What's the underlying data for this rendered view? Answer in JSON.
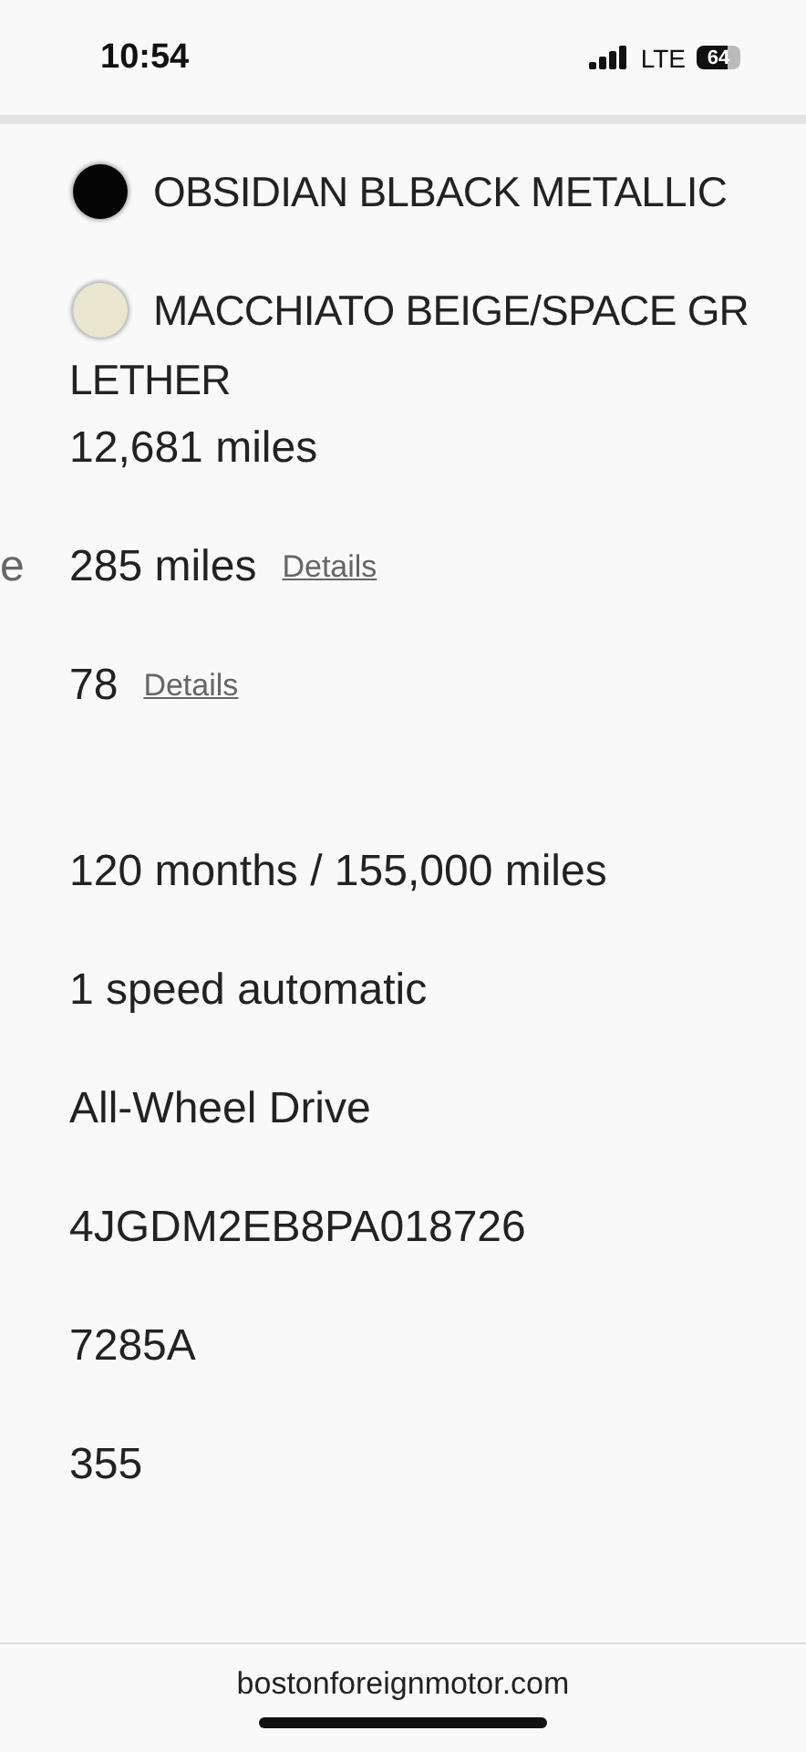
{
  "status_bar": {
    "time": "10:54",
    "network": "LTE",
    "battery": "64"
  },
  "specs": [
    {
      "kind": "swatch",
      "value": "OBSIDIAN BLBACK METALLIC",
      "color": "#050505"
    },
    {
      "kind": "swatch",
      "value": "MACCHIATO BEIGE/SPACE GR",
      "color": "#e8e6cf",
      "continuation": "LETHER"
    },
    {
      "kind": "text",
      "value": "12,681 miles"
    },
    {
      "kind": "link",
      "label": "e",
      "value": "285 miles",
      "link": "Details"
    },
    {
      "kind": "link",
      "value": "78",
      "link": "Details"
    },
    {
      "kind": "blank"
    },
    {
      "kind": "text",
      "value": "120 months / 155,000 miles"
    },
    {
      "kind": "text",
      "value": "1 speed automatic"
    },
    {
      "kind": "text",
      "value": "All-Wheel Drive"
    },
    {
      "kind": "text",
      "value": "4JGDM2EB8PA018726"
    },
    {
      "kind": "text",
      "value": "7285A"
    },
    {
      "kind": "text",
      "value": "355"
    }
  ],
  "footer": {
    "url": "bostonforeignmotor.com"
  }
}
